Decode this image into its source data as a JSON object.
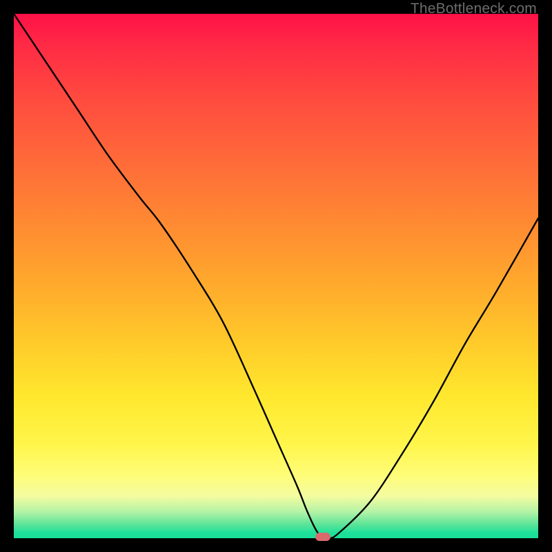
{
  "watermark_text": "TheBottleneck.com",
  "chart_data": {
    "type": "line",
    "title": "",
    "xlabel": "",
    "ylabel": "",
    "xlim": [
      0,
      100
    ],
    "ylim": [
      0,
      100
    ],
    "grid": false,
    "series": [
      {
        "name": "bottleneck-curve",
        "x": [
          0,
          6,
          12,
          18,
          24,
          28,
          34,
          40,
          46,
          50,
          54,
          56,
          58,
          60,
          62,
          68,
          74,
          80,
          86,
          92,
          100
        ],
        "y": [
          100,
          91,
          82,
          73,
          65,
          60,
          51,
          41,
          28,
          19,
          10,
          5,
          1,
          0,
          1,
          7,
          16,
          26,
          37,
          47,
          61
        ]
      }
    ],
    "annotations": [
      {
        "name": "optimal-marker",
        "x": 59,
        "y": 0,
        "color": "#d96a6e"
      }
    ],
    "background_gradient": {
      "direction": "vertical",
      "stops": [
        {
          "pos": 0,
          "color": "#ff1147"
        },
        {
          "pos": 0.5,
          "color": "#ffab2c"
        },
        {
          "pos": 0.82,
          "color": "#fff54a"
        },
        {
          "pos": 0.97,
          "color": "#58e398"
        },
        {
          "pos": 1.0,
          "color": "#19df99"
        }
      ]
    }
  }
}
